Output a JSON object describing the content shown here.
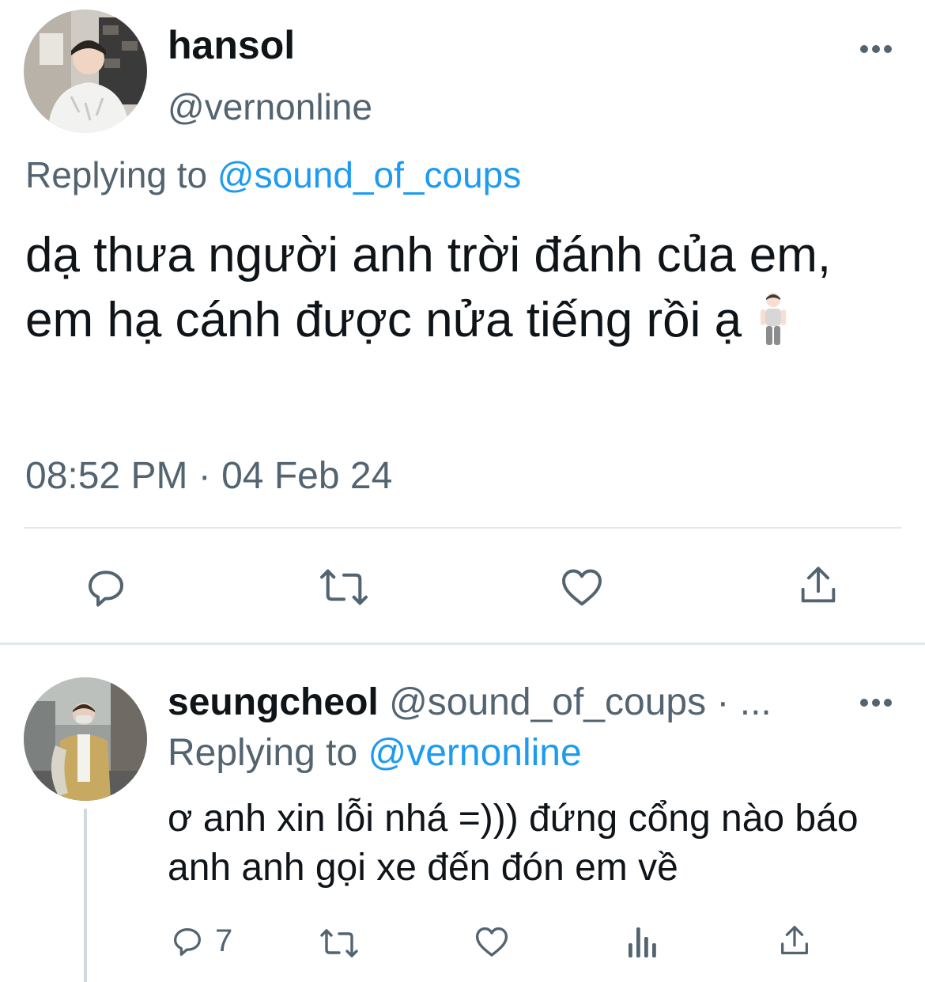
{
  "main_tweet": {
    "display_name": "hansol",
    "handle": "@vernonline",
    "replying_label": "Replying to",
    "replying_to": "@sound_of_coups",
    "text": "dạ thưa người anh trời đánh của em, em hạ cánh được nửa tiếng rồi ạ",
    "emoji": "standing-person-emoji",
    "timestamp": "08:52 PM · 04 Feb 24",
    "actions": [
      "reply-icon",
      "retweet-icon",
      "like-icon",
      "share-icon"
    ]
  },
  "reply_tweet": {
    "display_name": "seungcheol",
    "handle": "@sound_of_coups · ...",
    "replying_label": "Replying to",
    "replying_to": "@vernonline",
    "text": "ơ anh xin lỗi nhá =))) đứng cổng nào báo anh anh gọi xe đến đón em về",
    "reply_count": "7",
    "actions": [
      "reply-icon",
      "retweet-icon",
      "like-icon",
      "analytics-icon",
      "share-icon"
    ]
  },
  "colors": {
    "text": "#0f1419",
    "secondary": "#536471",
    "link": "#1d9bf0",
    "divider": "#e1e8ed"
  }
}
